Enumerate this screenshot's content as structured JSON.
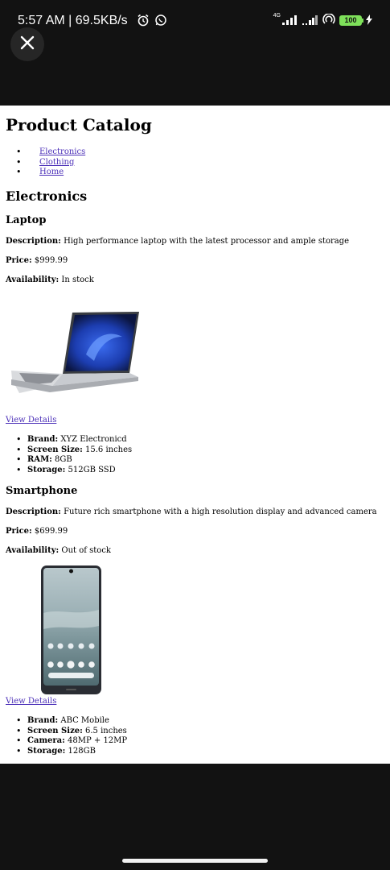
{
  "status_bar": {
    "time_speed": "5:57 AM | 69.5KB/s",
    "network": "4G",
    "battery": "100"
  },
  "page": {
    "title": "Product Catalog",
    "nav": [
      "Electronics",
      "Clothing",
      "Home"
    ],
    "section_title": "Electronics",
    "products": [
      {
        "name": "Laptop",
        "description_label": "Description:",
        "description": "High performance laptop with the latest processor and ample storage",
        "price_label": "Price:",
        "price": "$999.99",
        "availability_label": "Availability:",
        "availability": "In stock",
        "link": "View Details",
        "specs": [
          {
            "label": "Brand:",
            "value": "XYZ Electronicd"
          },
          {
            "label": "Screen Size:",
            "value": "15.6 inches"
          },
          {
            "label": "RAM:",
            "value": "8GB"
          },
          {
            "label": "Storage:",
            "value": "512GB SSD"
          }
        ]
      },
      {
        "name": "Smartphone",
        "description_label": "Description:",
        "description": "Future rich smartphone with a high resolution display and advanced camera",
        "price_label": "Price:",
        "price": "$699.99",
        "availability_label": "Availability:",
        "availability": "Out of stock",
        "link": "View Details",
        "specs": [
          {
            "label": "Brand:",
            "value": "ABC Mobile"
          },
          {
            "label": "Screen Size:",
            "value": "6.5 inches"
          },
          {
            "label": "Camera:",
            "value": "48MP + 12MP"
          },
          {
            "label": "Storage:",
            "value": "128GB"
          }
        ]
      }
    ]
  }
}
